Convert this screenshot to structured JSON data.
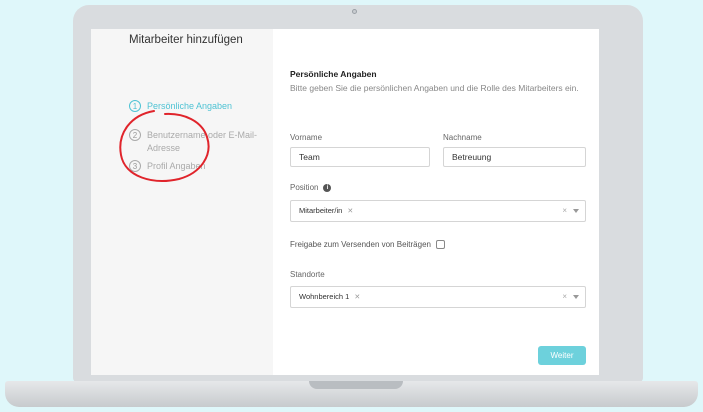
{
  "sidebar": {
    "title": "Mitarbeiter hinzufügen",
    "steps": [
      {
        "number": "1",
        "label": "Persönliche Angaben",
        "active": true
      },
      {
        "number": "2",
        "label": "Benutzername oder E-Mail-Adresse",
        "active": false
      },
      {
        "number": "3",
        "label": "Profil Angaben",
        "active": false
      }
    ]
  },
  "form": {
    "section_title": "Persönliche Angaben",
    "section_description": "Bitte geben Sie die persönlichen Angaben und die Rolle des Mitarbeiters ein.",
    "firstname": {
      "label": "Vorname",
      "value": "Team"
    },
    "lastname": {
      "label": "Nachname",
      "value": "Betreuung"
    },
    "position": {
      "label": "Position",
      "selected": "Mitarbeiter/in"
    },
    "share": {
      "label": "Freigabe zum Versenden von Beiträgen",
      "checked": false
    },
    "locations": {
      "label": "Standorte",
      "selected": "Wohnbereich 1"
    },
    "next_label": "Weiter"
  },
  "colors": {
    "accent": "#4fc3d4",
    "button": "#6dd1dc",
    "background": "#dff7fa",
    "annotation": "#e0242b"
  },
  "icons": {
    "info": "info-icon",
    "remove": "close-icon",
    "dropdown": "chevron-down-icon"
  }
}
